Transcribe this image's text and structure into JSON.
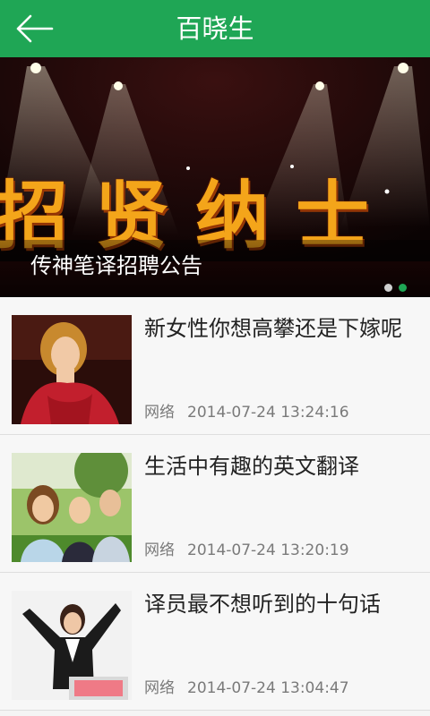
{
  "header": {
    "title": "百晓生",
    "back_icon": "arrow-left-icon"
  },
  "banner": {
    "caption": "传神笔译招聘公告",
    "image_text": "招贤纳士",
    "slide_count": 2,
    "active_slide": 2
  },
  "articles": [
    {
      "title": "新女性你想高攀还是下嫁呢",
      "source": "网络",
      "time": "2014-07-24 13:24:16"
    },
    {
      "title": "生活中有趣的英文翻译",
      "source": "网络",
      "time": "2014-07-24 13:20:19"
    },
    {
      "title": "译员最不想听到的十句话",
      "source": "网络",
      "time": "2014-07-24 13:04:47"
    }
  ],
  "colors": {
    "accent": "#1fa655"
  }
}
